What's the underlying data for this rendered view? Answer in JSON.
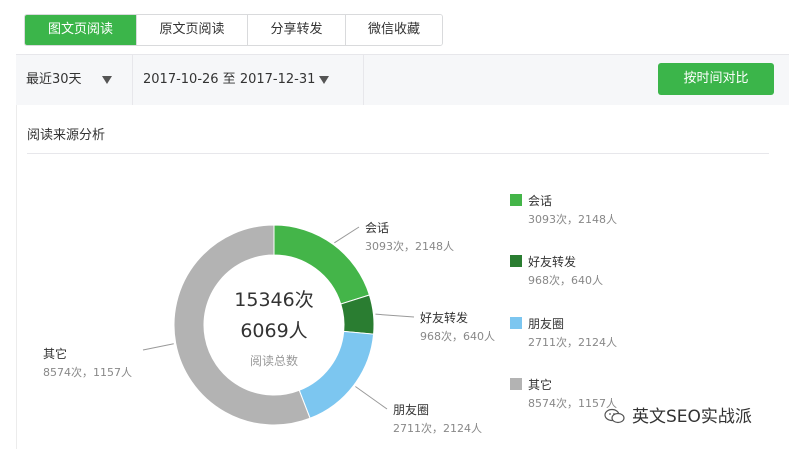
{
  "tabs": [
    "图文页阅读",
    "原文页阅读",
    "分享转发",
    "微信收藏"
  ],
  "filters": {
    "range_label": "最近30天",
    "date_range": "2017-10-26 至 2017-12-31",
    "compare_button": "按时间对比"
  },
  "section": {
    "title": "阅读来源分析"
  },
  "center": {
    "reads": "15346次",
    "users": "6069人",
    "caption": "阅读总数"
  },
  "chart_data": {
    "type": "pie",
    "donut": true,
    "categories": [
      "会话",
      "好友转发",
      "朋友圈",
      "其它"
    ],
    "values": [
      3093,
      968,
      2711,
      8574
    ],
    "users": [
      2148,
      640,
      2124,
      1157
    ],
    "labels": [
      {
        "name": "会话",
        "stats": "3093次，2148人"
      },
      {
        "name": "好友转发",
        "stats": "968次，640人"
      },
      {
        "name": "朋友圈",
        "stats": "2711次，2124人"
      },
      {
        "name": "其它",
        "stats": "8574次，1157人"
      }
    ],
    "colors": [
      "#44b549",
      "#2a7d31",
      "#7cc6f0",
      "#b3b3b3"
    ],
    "total": {
      "reads": 15346,
      "users": 6069
    }
  },
  "legend": [
    {
      "name": "会话",
      "stats": "3093次，2148人",
      "color": "#44b549"
    },
    {
      "name": "好友转发",
      "stats": "968次，640人",
      "color": "#2a7d31"
    },
    {
      "name": "朋友圈",
      "stats": "2711次，2124人",
      "color": "#7cc6f0"
    },
    {
      "name": "其它",
      "stats": "8574次，1157人",
      "color": "#b3b3b3"
    }
  ],
  "watermark": {
    "text": "英文SEO实战派",
    "icon": "wechat-icon"
  }
}
